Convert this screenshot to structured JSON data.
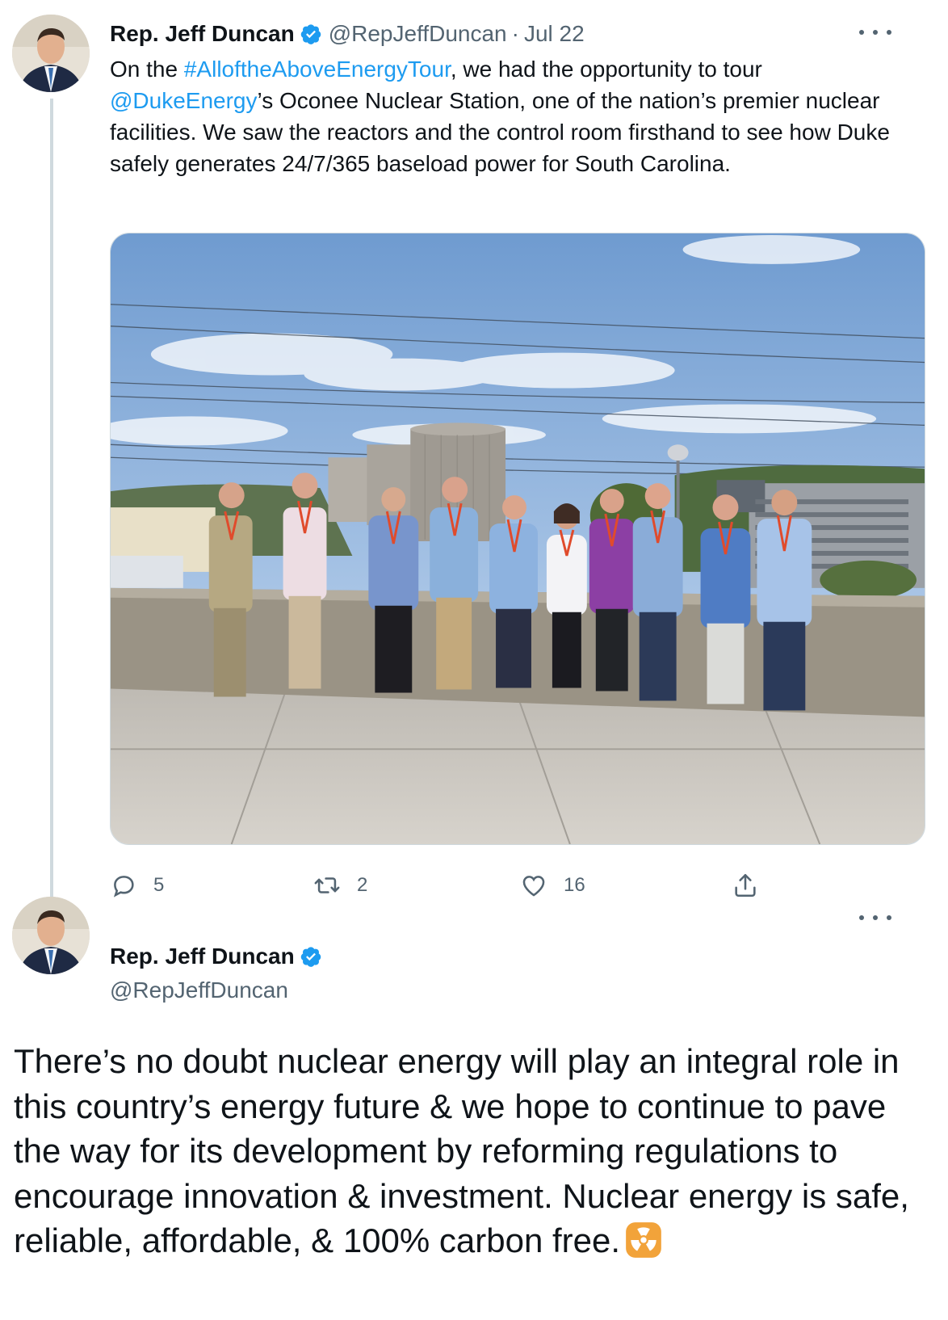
{
  "tweet1": {
    "author_name": "Rep. Jeff Duncan",
    "handle": "@RepJeffDuncan",
    "separator": "·",
    "date": "Jul 22",
    "text_parts": {
      "prefix": "On the ",
      "hashtag": "#AlloftheAboveEnergyTour",
      "middle": ", we had the opportunity to tour ",
      "mention": "@DukeEnergy",
      "suffix": "’s Oconee Nuclear Station, one of the nation’s premier nuclear facilities. We saw the reactors and the control room firsthand to see how Duke safely generates 24/7/365 baseload power for South Carolina."
    },
    "icon_avatar": "avatar-photo",
    "icon_verified": "verified-badge-icon",
    "icon_more": "more-options-icon",
    "media_image": "group-photo-nuclear-station",
    "actions": {
      "replies": "5",
      "retweets": "2",
      "likes": "16",
      "reply_icon": "reply-icon",
      "retweet_icon": "retweet-icon",
      "like_icon": "heart-icon",
      "share_icon": "share-icon"
    }
  },
  "tweet2": {
    "author_name": "Rep. Jeff Duncan",
    "handle": "@RepJeffDuncan",
    "text": "There’s no doubt nuclear energy will play an integral role in this country’s energy future & we hope to continue to pave the way for its development by reforming regulations to encourage innovation & investment. Nuclear energy is safe, reliable, affordable, & 100% carbon free.",
    "emoji": "radioactive-emoji"
  },
  "colors": {
    "link": "#1d9bf0",
    "verified": "#1d9bf0",
    "secondary_text": "#536471",
    "thread_line": "#cfd9de"
  }
}
